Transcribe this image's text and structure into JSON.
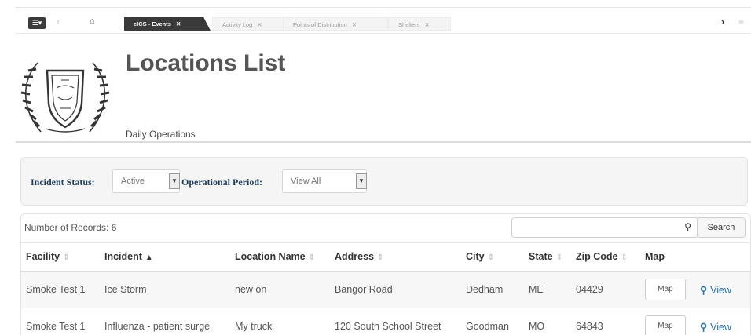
{
  "tabs": [
    {
      "label": "eICS - Events",
      "active": true
    },
    {
      "label": "Activity Log",
      "active": false
    },
    {
      "label": "Points of Distribution",
      "active": false
    },
    {
      "label": "Shelters",
      "active": false
    }
  ],
  "icons": {
    "menu": "menu-icon",
    "back": "chevron-left-icon",
    "home": "home-icon",
    "forward": "chevron-right-icon",
    "list": "list-icon",
    "search": "search-icon",
    "view": "search-icon"
  },
  "header": {
    "title": "Locations List",
    "subtitle": "Daily Operations"
  },
  "filters": {
    "incident_status_label": "Incident Status:",
    "incident_status_value": "Active",
    "operational_period_label": "Operational Period:",
    "operational_period_value": "View All"
  },
  "records": {
    "count_text": "Number of Records: 6",
    "search_placeholder": "",
    "search_button": "Search"
  },
  "table": {
    "columns": [
      "Facility",
      "Incident",
      "Location Name",
      "Address",
      "City",
      "State",
      "Zip Code",
      "Map"
    ],
    "rows": [
      {
        "facility": "Smoke Test 1",
        "incident": "Ice Storm",
        "location_name": "new on",
        "address": "Bangor Road",
        "city": "Dedham",
        "state": "ME",
        "zip": "04429",
        "map": "Map",
        "view": "View"
      },
      {
        "facility": "Smoke Test 1",
        "incident": "Influenza - patient surge",
        "location_name": "My truck",
        "address": "120 South School Street",
        "city": "Goodman",
        "state": "MO",
        "zip": "64843",
        "map": "Map",
        "view": "View"
      }
    ]
  },
  "colors": {
    "accent_link": "#2a6fb0",
    "active_tab": "#3a3a3a",
    "filter_label": "#1f3d5c"
  }
}
